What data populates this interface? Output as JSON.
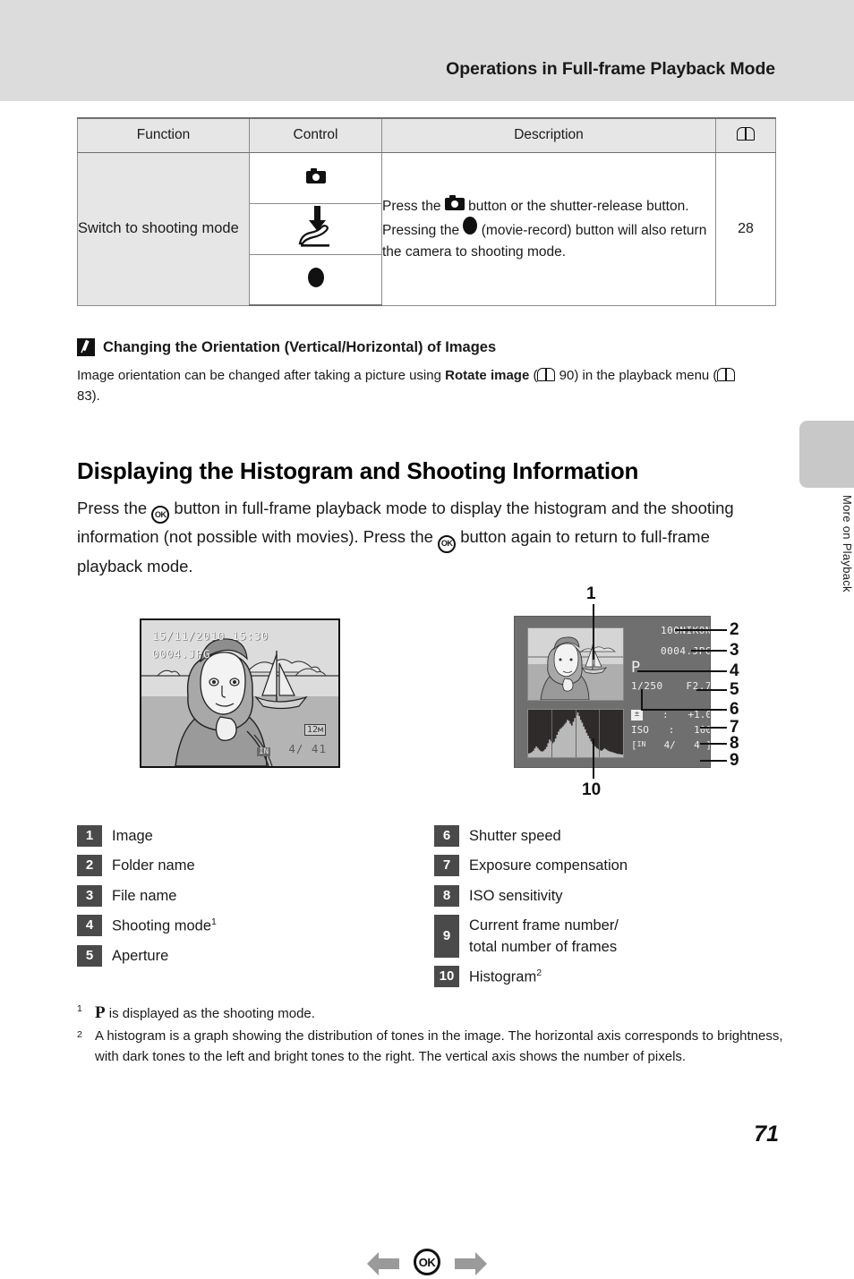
{
  "header": {
    "title": "Operations in Full-frame Playback Mode"
  },
  "side_tab": {
    "label": "More on Playback"
  },
  "table": {
    "columns": [
      "Function",
      "Control",
      "Description",
      "book-icon"
    ],
    "rows": [
      {
        "function": "Switch to shooting mode",
        "controls": [
          "camera-button-icon",
          "shutter-release-icon",
          "movie-record-button-icon"
        ],
        "description": "Press the   button or the shutter-release button. Pressing the   (movie-record) button will also return the camera to shooting mode.",
        "description_parts": {
          "p1": "Press the ",
          "p2": " button or the shutter-release button. Pressing the ",
          "p3": " (movie-record) button will also return the camera to shooting mode."
        },
        "page": "28"
      }
    ]
  },
  "note": {
    "icon": "pencil-icon",
    "title": "Changing the Orientation (Vertical/Horizontal) of Images",
    "body_p1": "Image orientation can be changed after taking a picture using ",
    "body_bold": "Rotate image",
    "body_p2": " (",
    "body_ref1": "90) in the playback menu (",
    "body_ref2": "83)."
  },
  "section": {
    "heading": "Displaying the Histogram and Shooting Information",
    "para_p1": "Press the ",
    "para_p2": " button in full-frame playback mode to display the histogram and the shooting information (not possible with movies). Press the ",
    "para_p3": " button again to return to full-frame playback mode."
  },
  "figure": {
    "ok_button_label": "OK",
    "left_screen": {
      "date": "15/11/2010 15:30",
      "file_name": "0004.JPG",
      "image_size_badge": "12м",
      "memory_badge": "IN",
      "frame_counter": "4/  41"
    },
    "right_screen": {
      "folder_name": "100NIKON",
      "file_name": "0004.JPG",
      "shooting_mode": "P",
      "shutter_speed": "1/250",
      "aperture": "F2.7",
      "exposure_comp_icon": "exposure-compensation-icon",
      "exposure_comp_sep": ":",
      "exposure_comp_value": "+1.0",
      "iso_label": "ISO",
      "iso_sep": ":",
      "iso_value": "100",
      "frames_prefix": "[",
      "frames_memory": "IN",
      "frames_current": "4/",
      "frames_total": "4 ]"
    },
    "callouts": {
      "c1": "1",
      "c2": "2",
      "c3": "3",
      "c4": "4",
      "c5": "5",
      "c6": "6",
      "c7": "7",
      "c8": "8",
      "c9": "9",
      "c10": "10"
    },
    "histogram": {
      "bins": [
        8,
        9,
        11,
        14,
        19,
        23,
        20,
        16,
        13,
        12,
        14,
        17,
        22,
        30,
        38,
        34,
        30,
        33,
        40,
        48,
        55,
        60,
        63,
        66,
        70,
        74,
        80,
        78,
        72,
        68,
        76,
        84,
        90,
        96,
        88,
        80,
        74,
        66,
        60,
        52,
        46,
        40,
        34,
        29,
        25,
        22,
        19,
        17,
        15,
        14,
        16,
        19,
        17,
        15,
        13,
        12,
        11,
        10,
        9,
        8,
        7,
        7,
        6,
        6
      ],
      "gridlines": 3
    }
  },
  "legend": {
    "left": [
      {
        "num": "1",
        "label": "Image"
      },
      {
        "num": "2",
        "label": "Folder name"
      },
      {
        "num": "3",
        "label": "File name"
      },
      {
        "num": "4",
        "label": "Shooting mode",
        "sup": "1"
      },
      {
        "num": "5",
        "label": "Aperture"
      }
    ],
    "right": [
      {
        "num": "6",
        "label": "Shutter speed"
      },
      {
        "num": "7",
        "label": "Exposure compensation"
      },
      {
        "num": "8",
        "label": "ISO sensitivity"
      },
      {
        "num": "9",
        "label": "Current frame number/ total number of frames",
        "line1": "Current frame number/",
        "line2": "total number of frames"
      },
      {
        "num": "10",
        "label": "Histogram",
        "sup": "2"
      }
    ]
  },
  "footnotes": {
    "f1_mark": "1",
    "f1_mode": "P",
    "f1_text": " is displayed as the shooting mode.",
    "f2_mark": "2",
    "f2_text": "A histogram is a graph showing the distribution of tones in the image. The horizontal axis corresponds to brightness, with dark tones to the left and bright tones to the right. The vertical axis shows the number of pixels."
  },
  "page_number": "71"
}
